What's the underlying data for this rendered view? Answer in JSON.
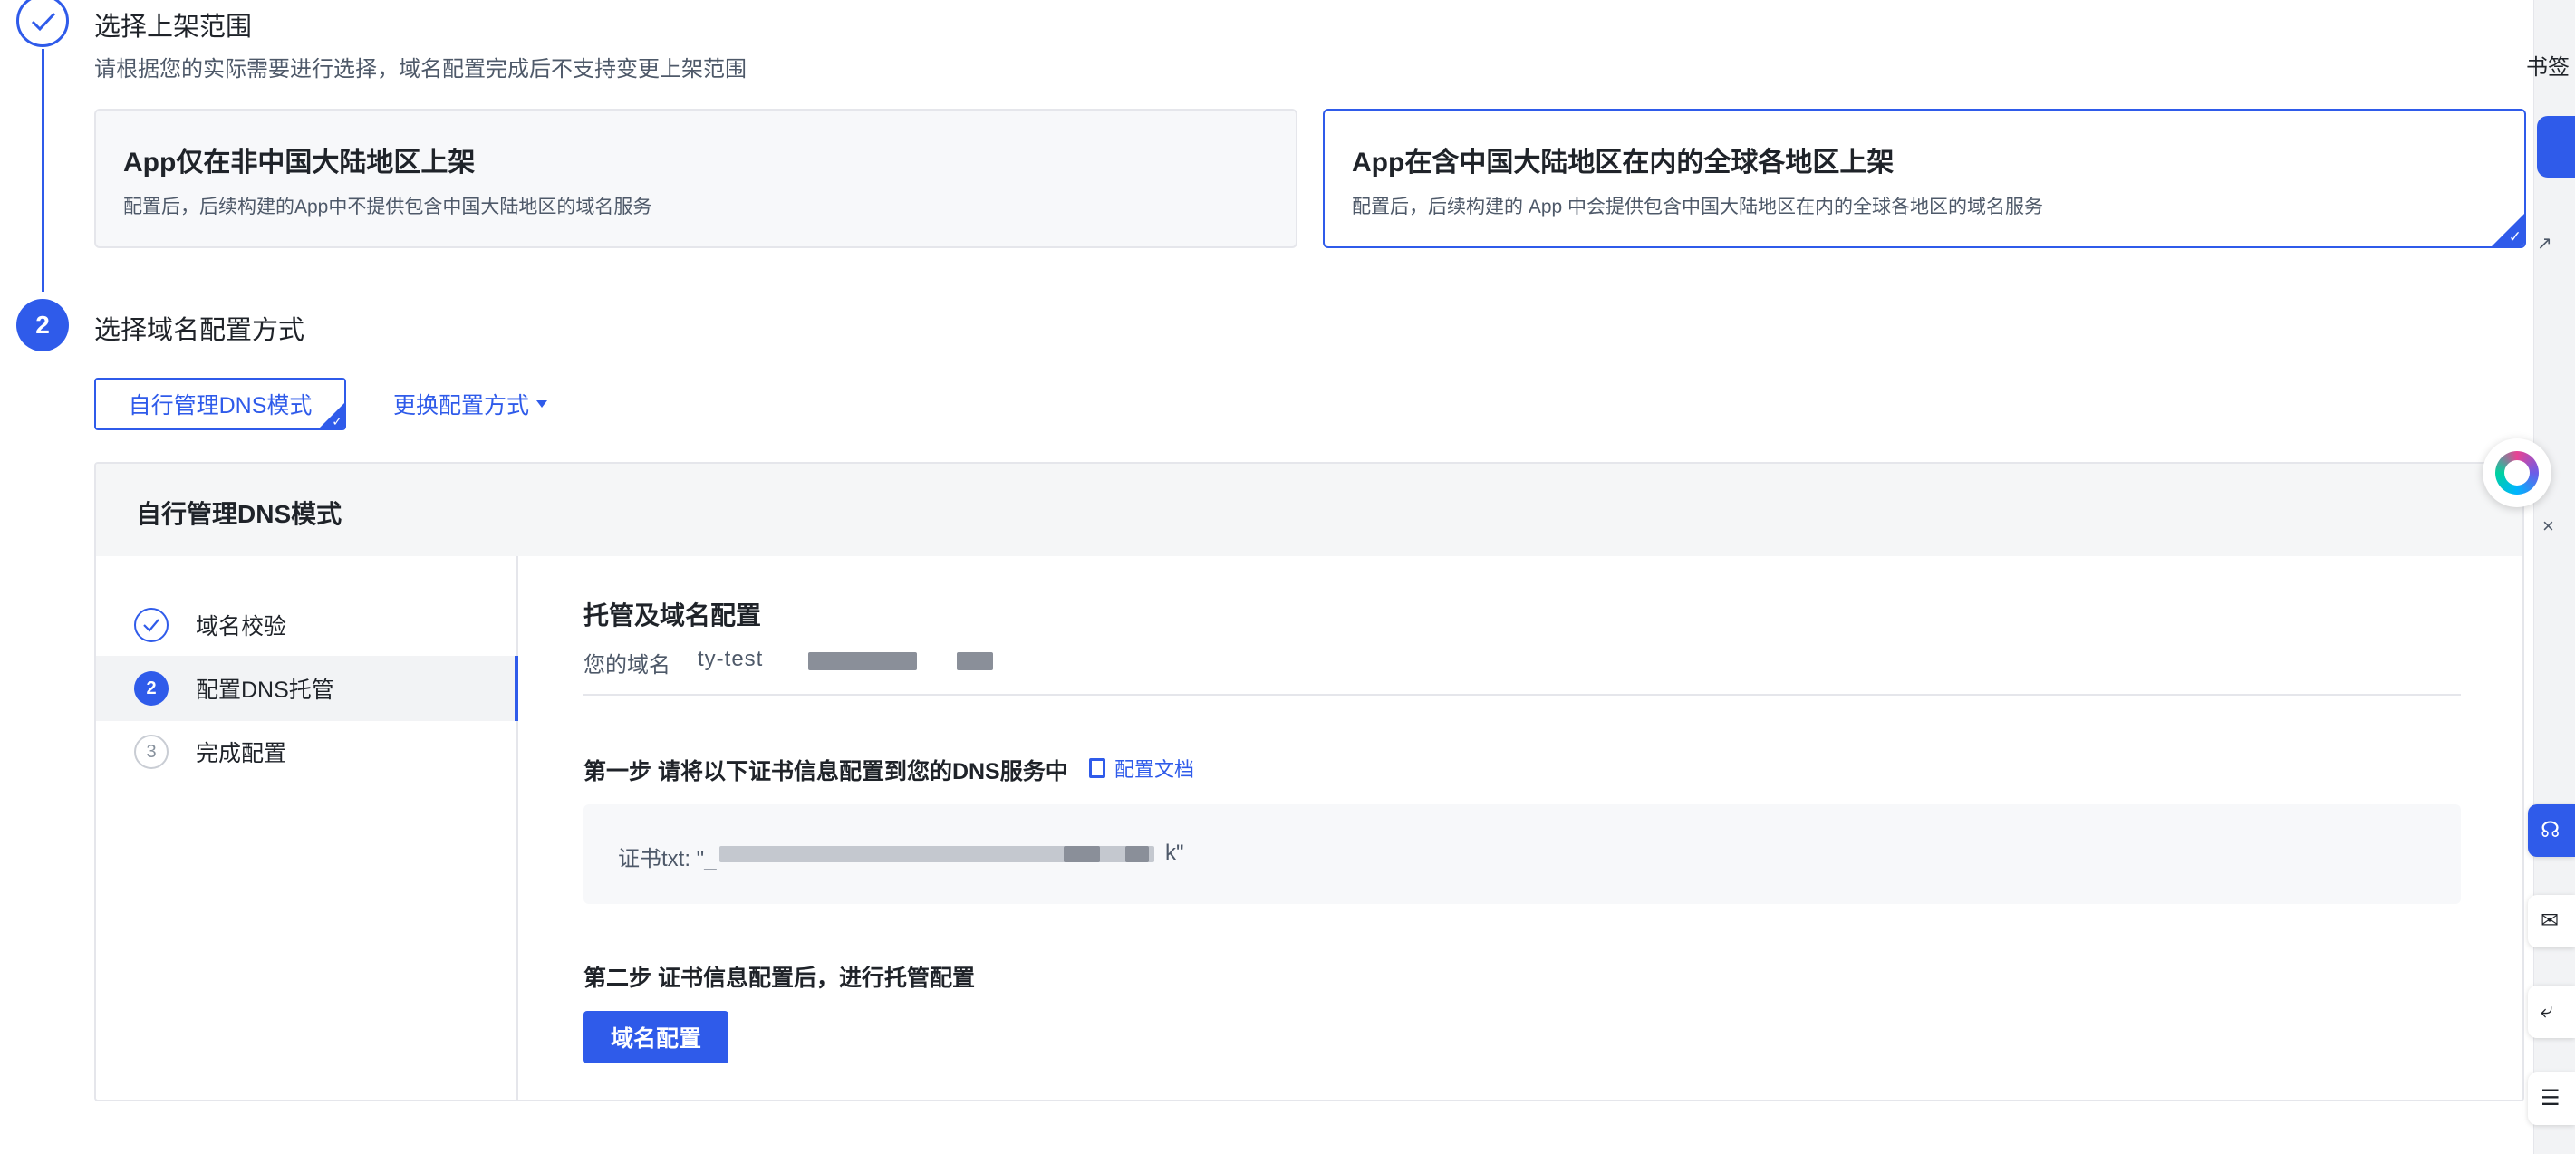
{
  "step1": {
    "title": "选择上架范围",
    "description": "请根据您的实际需要进行选择，域名配置完成后不支持变更上架范围",
    "options": [
      {
        "title": "App仅在非中国大陆地区上架",
        "description": "配置后，后续构建的App中不提供包含中国大陆地区的域名服务",
        "selected": false
      },
      {
        "title": "App在含中国大陆地区在内的全球各地区上架",
        "description": "配置后，后续构建的 App 中会提供包含中国大陆地区在内的全球各地区的域名服务",
        "selected": true
      }
    ]
  },
  "step2": {
    "number": "2",
    "title": "选择域名配置方式",
    "mode_button": "自行管理DNS模式",
    "switch_link": "更换配置方式"
  },
  "panel": {
    "header": "自行管理DNS模式",
    "side_items": [
      {
        "label": "域名校验",
        "status": "done"
      },
      {
        "label": "配置DNS托管",
        "number": "2",
        "status": "active"
      },
      {
        "label": "完成配置",
        "number": "3",
        "status": "pending"
      }
    ],
    "content_title": "托管及域名配置",
    "domain_label": "您的域名",
    "domain_value": "ty-test",
    "step_one": "第一步 请将以下证书信息配置到您的DNS服务中",
    "doc_link": "配置文档",
    "cert_text": "证书txt: \"_",
    "cert_text_end": "k\"",
    "step_two": "第二步 证书信息配置后，进行托管配置",
    "domain_button": "域名配置"
  },
  "right_strip": {
    "bookmark_text": "书签",
    "icons": [
      "external-link-icon",
      "assistant-icon",
      "headset-icon",
      "chat-icon",
      "reply-icon",
      "menu-icon"
    ]
  },
  "colors": {
    "primary": "#2f5bea",
    "text": "#1f2329",
    "secondary_text": "#4e5969",
    "border": "#e5e6eb"
  }
}
